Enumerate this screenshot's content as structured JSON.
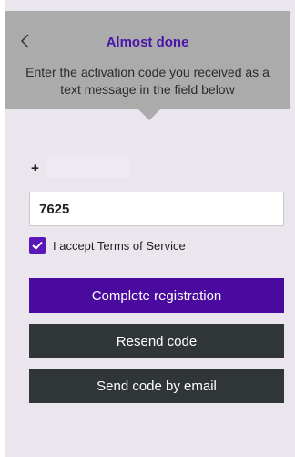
{
  "header": {
    "title": "Almost done",
    "subtitle": "Enter the activation code you received as a text message in the field below",
    "back_icon": "chevron-left-icon"
  },
  "form": {
    "country_prefix": "+",
    "phone_value": "",
    "code_value": "7625",
    "terms_checked": true,
    "terms_label": "I accept Terms of Service"
  },
  "buttons": {
    "complete_label": "Complete registration",
    "resend_label": "Resend code",
    "email_label": "Send code by email"
  },
  "colors": {
    "accent": "#4a0aa0",
    "title": "#4a14a8",
    "dark_button": "#303637",
    "header_bg": "#ababab",
    "screen_bg": "#ebe5ee"
  }
}
